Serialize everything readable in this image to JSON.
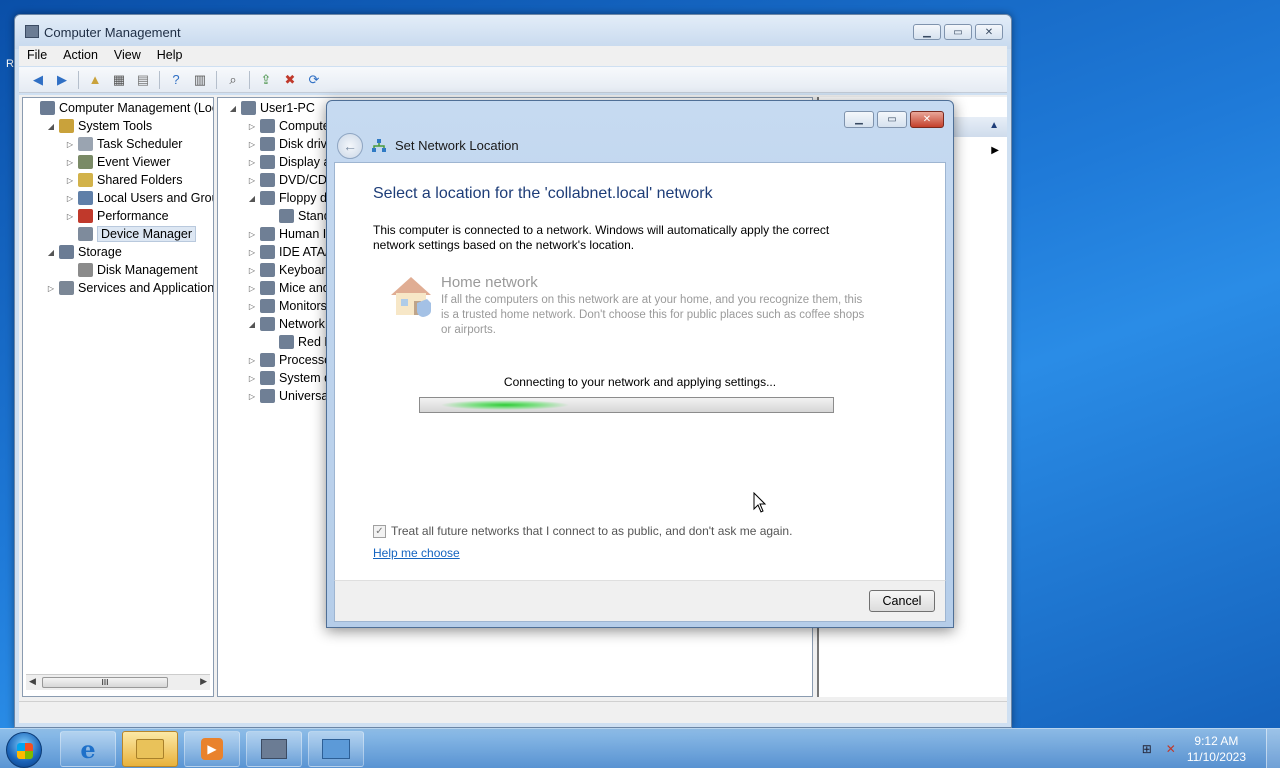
{
  "desktop": {
    "stub_text": "R"
  },
  "window": {
    "title": "Computer Management",
    "menu": [
      "File",
      "Action",
      "View",
      "Help"
    ]
  },
  "left_tree": [
    {
      "label": "Computer Management (Local",
      "level": 0,
      "expander": "",
      "icon_color": "#6b7c94"
    },
    {
      "label": "System Tools",
      "level": 1,
      "expander": "◢",
      "icon_color": "#c9a23b"
    },
    {
      "label": "Task Scheduler",
      "level": 2,
      "expander": "▷",
      "icon_color": "#9aa4b1"
    },
    {
      "label": "Event Viewer",
      "level": 2,
      "expander": "▷",
      "icon_color": "#7a8a66"
    },
    {
      "label": "Shared Folders",
      "level": 2,
      "expander": "▷",
      "icon_color": "#d2b24a"
    },
    {
      "label": "Local Users and Groups",
      "level": 2,
      "expander": "▷",
      "icon_color": "#5f7fa8"
    },
    {
      "label": "Performance",
      "level": 2,
      "expander": "▷",
      "icon_color": "#c0392b"
    },
    {
      "label": "Device Manager",
      "level": 2,
      "expander": "",
      "icon_color": "#7e8b9c",
      "selected": true
    },
    {
      "label": "Storage",
      "level": 1,
      "expander": "◢",
      "icon_color": "#6b7c94"
    },
    {
      "label": "Disk Management",
      "level": 2,
      "expander": "",
      "icon_color": "#8b8b8b"
    },
    {
      "label": "Services and Applications",
      "level": 1,
      "expander": "▷",
      "icon_color": "#7b8796"
    }
  ],
  "device_tree": [
    {
      "label": "User1-PC",
      "level": 0,
      "expander": "◢"
    },
    {
      "label": "Compute",
      "level": 1,
      "expander": "▷"
    },
    {
      "label": "Disk drive",
      "level": 1,
      "expander": "▷"
    },
    {
      "label": "Display a",
      "level": 1,
      "expander": "▷"
    },
    {
      "label": "DVD/CD-",
      "level": 1,
      "expander": "▷"
    },
    {
      "label": "Floppy d",
      "level": 1,
      "expander": "◢"
    },
    {
      "label": "Stand",
      "level": 2,
      "expander": ""
    },
    {
      "label": "Human I",
      "level": 1,
      "expander": "▷"
    },
    {
      "label": "IDE ATA/",
      "level": 1,
      "expander": "▷"
    },
    {
      "label": "Keyboar",
      "level": 1,
      "expander": "▷"
    },
    {
      "label": "Mice and",
      "level": 1,
      "expander": "▷"
    },
    {
      "label": "Monitors",
      "level": 1,
      "expander": "▷"
    },
    {
      "label": "Network",
      "level": 1,
      "expander": "◢"
    },
    {
      "label": "Red H",
      "level": 2,
      "expander": ""
    },
    {
      "label": "Processo",
      "level": 1,
      "expander": "▷"
    },
    {
      "label": "System d",
      "level": 1,
      "expander": "▷"
    },
    {
      "label": "Universal",
      "level": 1,
      "expander": "▷"
    }
  ],
  "dialog": {
    "title": "Set Network Location",
    "heading": "Select a location for the 'collabnet.local' network",
    "intro": "This computer is connected to a network. Windows will automatically apply the correct network settings based on the network's location.",
    "option_title": "Home network",
    "option_desc": "If all the computers on this network are at your home, and you recognize them, this is a trusted home network.  Don't choose this for public places such as coffee shops or airports.",
    "progress_label": "Connecting to your network and applying settings...",
    "checkbox_label": "Treat all future networks that I connect to as public, and don't ask me again.",
    "checkbox_checked": true,
    "help_link": "Help me choose",
    "cancel_label": "Cancel"
  },
  "taskbar": {
    "time": "9:12 AM",
    "date": "11/10/2023"
  }
}
